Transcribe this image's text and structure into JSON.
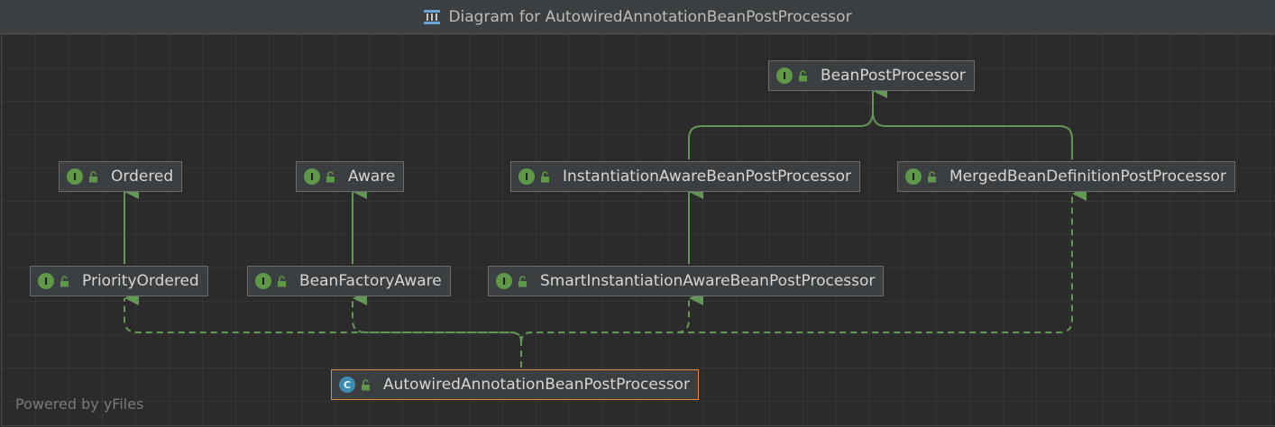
{
  "window": {
    "title": "Diagram for AutowiredAnnotationBeanPostProcessor",
    "title_icon": "diagram-icon"
  },
  "nodes": {
    "bean_post_processor": {
      "label": "BeanPostProcessor",
      "badge": "I",
      "kind": "interface"
    },
    "ordered": {
      "label": "Ordered",
      "badge": "I",
      "kind": "interface"
    },
    "aware": {
      "label": "Aware",
      "badge": "I",
      "kind": "interface"
    },
    "instantiation_aware": {
      "label": "InstantiationAwareBeanPostProcessor",
      "badge": "I",
      "kind": "interface"
    },
    "merged_bean_definition": {
      "label": "MergedBeanDefinitionPostProcessor",
      "badge": "I",
      "kind": "interface"
    },
    "priority_ordered": {
      "label": "PriorityOrdered",
      "badge": "I",
      "kind": "interface"
    },
    "bean_factory_aware": {
      "label": "BeanFactoryAware",
      "badge": "I",
      "kind": "interface"
    },
    "smart_instantiation_aware": {
      "label": "SmartInstantiationAwareBeanPostProcessor",
      "badge": "I",
      "kind": "interface"
    },
    "autowired_annotation": {
      "label": "AutowiredAnnotationBeanPostProcessor",
      "badge": "C",
      "kind": "class",
      "selected": true
    }
  },
  "edges": [
    {
      "from": "instantiation_aware",
      "to": "bean_post_processor",
      "style": "extends"
    },
    {
      "from": "merged_bean_definition",
      "to": "bean_post_processor",
      "style": "extends"
    },
    {
      "from": "priority_ordered",
      "to": "ordered",
      "style": "extends"
    },
    {
      "from": "bean_factory_aware",
      "to": "aware",
      "style": "extends"
    },
    {
      "from": "smart_instantiation_aware",
      "to": "instantiation_aware",
      "style": "extends"
    },
    {
      "from": "autowired_annotation",
      "to": "priority_ordered",
      "style": "implements"
    },
    {
      "from": "autowired_annotation",
      "to": "bean_factory_aware",
      "style": "implements"
    },
    {
      "from": "autowired_annotation",
      "to": "smart_instantiation_aware",
      "style": "implements"
    },
    {
      "from": "autowired_annotation",
      "to": "merged_bean_definition",
      "style": "implements"
    }
  ],
  "footer": {
    "powered_by": "Powered by yFiles"
  },
  "colors": {
    "background": "#2b2b2b",
    "node_fill": "#3c3f41",
    "node_border": "#6b6b6b",
    "selected_border": "#e08a36",
    "interface_badge": "#5f9948",
    "class_badge": "#3d8cb1",
    "edge": "#629755",
    "text": "#d5d5d5"
  }
}
